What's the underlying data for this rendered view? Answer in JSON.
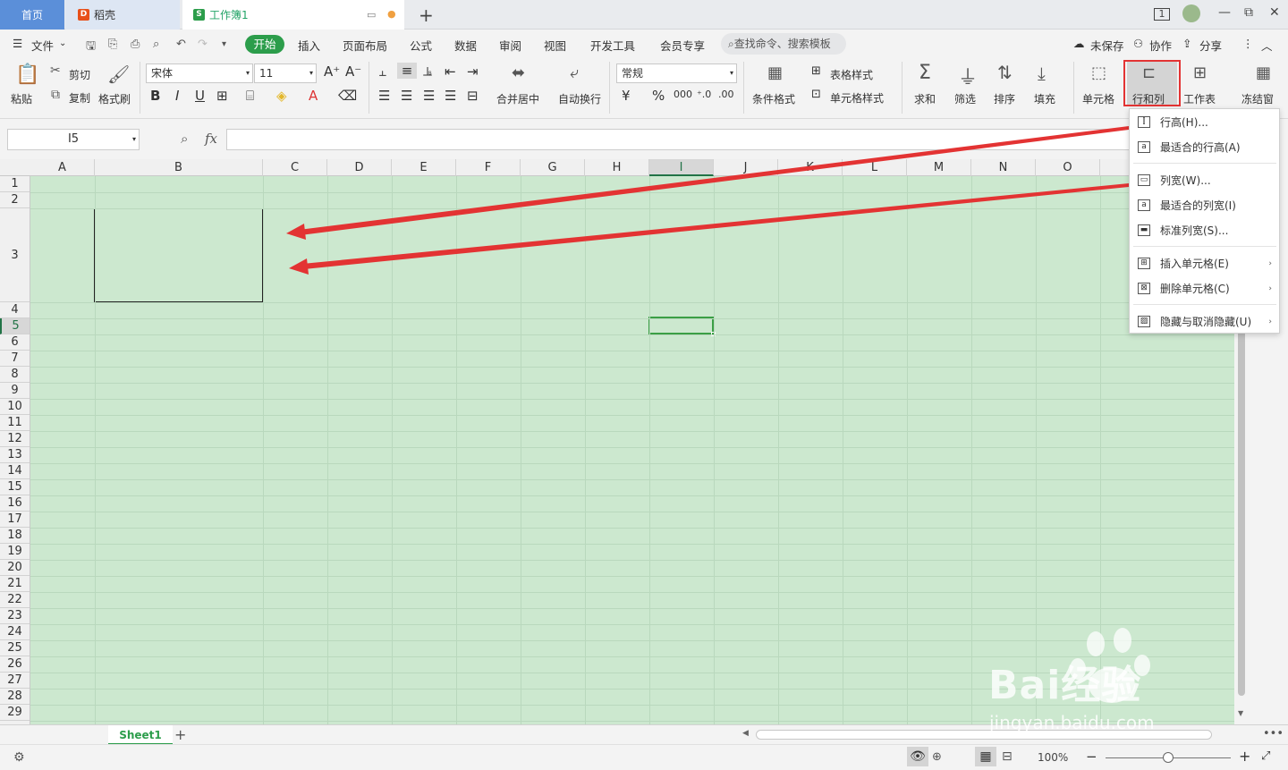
{
  "tabs": {
    "home": "首页",
    "daoke": "稻壳",
    "workbook": "工作簿1"
  },
  "menu": {
    "file": "文件",
    "start": "开始",
    "items": [
      "插入",
      "页面布局",
      "公式",
      "数据",
      "审阅",
      "视图",
      "开发工具",
      "会员专享"
    ],
    "search_placeholder": "查找命令、搜索模板",
    "unsaved": "未保存",
    "collab": "协作",
    "share": "分享"
  },
  "ribbon": {
    "paste": "粘贴",
    "cut": "剪切",
    "copy": "复制",
    "format_painter": "格式刷",
    "font_name": "宋体",
    "font_size": "11",
    "merge_center": "合并居中",
    "wrap_text": "自动换行",
    "number_format": "常规",
    "cond_format": "条件格式",
    "table_style": "表格样式",
    "cell_style": "单元格样式",
    "sum": "求和",
    "filter": "筛选",
    "sort": "排序",
    "fill": "填充",
    "cell": "单元格",
    "row_col": "行和列",
    "worksheet": "工作表",
    "freeze": "冻结窗"
  },
  "formula": {
    "name_box": "I5",
    "fx": "fx"
  },
  "grid": {
    "columns": [
      "A",
      "B",
      "C",
      "D",
      "E",
      "F",
      "G",
      "H",
      "I",
      "J",
      "K",
      "L",
      "M",
      "N",
      "O"
    ],
    "rows": [
      "1",
      "2",
      "3",
      "4",
      "5",
      "6",
      "7",
      "8",
      "9",
      "10",
      "11",
      "12",
      "13",
      "14",
      "15",
      "16",
      "17",
      "18",
      "19",
      "20",
      "21",
      "22",
      "23",
      "24",
      "25",
      "26",
      "27",
      "28",
      "29"
    ],
    "selected_column": "I",
    "selected_row": "5"
  },
  "dropdown": {
    "items": [
      {
        "label": "行高(H)...",
        "icon": "row-height-icon",
        "submenu": false
      },
      {
        "label": "最适合的行高(A)",
        "icon": "autofit-row-icon",
        "submenu": false
      },
      {
        "label": "列宽(W)...",
        "icon": "col-width-icon",
        "submenu": false
      },
      {
        "label": "最适合的列宽(I)",
        "icon": "autofit-col-icon",
        "submenu": false
      },
      {
        "label": "标准列宽(S)...",
        "icon": "standard-width-icon",
        "submenu": false
      },
      {
        "label": "插入单元格(E)",
        "icon": "insert-cell-icon",
        "submenu": true
      },
      {
        "label": "删除单元格(C)",
        "icon": "delete-cell-icon",
        "submenu": true
      },
      {
        "label": "隐藏与取消隐藏(U)",
        "icon": "hide-unhide-icon",
        "submenu": true
      }
    ]
  },
  "sheets": {
    "sheet1": "Sheet1"
  },
  "status": {
    "zoom": "100%"
  },
  "watermark": {
    "brand": "Bai经验",
    "url": "jingyan.baidu.com"
  },
  "colors": {
    "accent": "#2c9d4b",
    "grid_bg": "#cce8cf",
    "highlight": "#e33333"
  }
}
